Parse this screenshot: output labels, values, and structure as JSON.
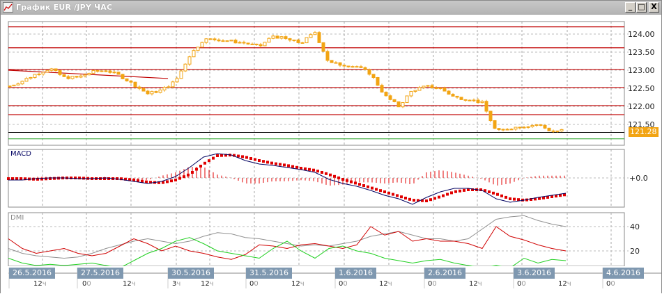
{
  "window": {
    "title": "График EUR /JPY  ЧАС",
    "minimize": "_",
    "maximize": "□",
    "close": "X"
  },
  "price_axis": {
    "labels": [
      "124.00",
      "123.50",
      "123.00",
      "122.50",
      "122.00",
      "121.50"
    ],
    "current_price": "121.28"
  },
  "macd": {
    "label": "MACD",
    "axis_label": "+0.0"
  },
  "dmi": {
    "label": "DMI",
    "axis_labels": [
      "40",
      "20"
    ]
  },
  "timeline": {
    "dates": [
      "26.5.2016",
      "27.5.2016",
      "30.5.2016",
      "31.5.2016",
      "1.6.2016",
      "2.6.2016",
      "3.6.2016",
      "4.6.2016"
    ],
    "hours": [
      [
        "12",
        "ч"
      ],
      [
        "0",
        "0"
      ],
      [
        "12",
        "ч"
      ],
      [
        "3",
        "ч"
      ],
      [
        "12",
        "ч"
      ],
      [
        "0",
        "0"
      ],
      [
        "12",
        "ч"
      ],
      [
        "0",
        "0"
      ],
      [
        "12",
        "ч"
      ],
      [
        "0",
        "0"
      ],
      [
        "12",
        "ч"
      ],
      [
        "0",
        "0"
      ],
      [
        "12",
        "ч"
      ],
      [
        "0",
        "0"
      ]
    ]
  },
  "colors": {
    "candle": "#f2a413",
    "level": "#c00000",
    "macd": "#000060",
    "signal": "#e00000",
    "adx": "#909090",
    "plus_di": "#d00000",
    "minus_di": "#20d020"
  },
  "chart_data": {
    "type": "line",
    "price_close": [
      122.55,
      122.7,
      122.9,
      123.05,
      122.8,
      122.8,
      122.95,
      123.0,
      122.85,
      122.6,
      122.35,
      122.45,
      122.7,
      123.4,
      123.85,
      123.85,
      123.8,
      123.75,
      123.65,
      123.95,
      123.85,
      123.75,
      124.05,
      123.2,
      123.15,
      123.1,
      122.9,
      122.3,
      122.0,
      122.45,
      122.55,
      122.5,
      122.25,
      122.2,
      122.1,
      121.3,
      121.4,
      121.45,
      121.5,
      121.3,
      121.35
    ],
    "levels": [
      124.2,
      123.62,
      123.02,
      122.52,
      122.02,
      121.77
    ],
    "black_level": 121.28,
    "green_level": 121.1,
    "trendline": [
      123.0,
      122.77
    ],
    "price_ylim": [
      121.0,
      124.35
    ],
    "macd": [
      -3,
      -3,
      -1,
      0,
      0,
      -1,
      -1,
      0,
      -2,
      -5,
      -8,
      -5,
      2,
      15,
      30,
      35,
      33,
      25,
      20,
      18,
      15,
      12,
      8,
      -2,
      -8,
      -12,
      -18,
      -25,
      -30,
      -38,
      -28,
      -20,
      -15,
      -15,
      -18,
      -30,
      -35,
      -32,
      -28,
      -25,
      -22
    ],
    "signal": [
      -1,
      -1,
      -2,
      -1,
      0,
      0,
      -1,
      -1,
      -1,
      -3,
      -6,
      -7,
      -3,
      5,
      20,
      32,
      33,
      30,
      25,
      21,
      18,
      14,
      11,
      5,
      -2,
      -8,
      -14,
      -20,
      -26,
      -32,
      -33,
      -27,
      -20,
      -17,
      -17,
      -23,
      -30,
      -32,
      -30,
      -27,
      -24
    ],
    "adx": [
      22,
      18,
      16,
      15,
      14,
      15,
      18,
      22,
      25,
      28,
      30,
      28,
      26,
      28,
      32,
      35,
      34,
      31,
      30,
      28,
      26,
      24,
      25,
      24,
      26,
      28,
      32,
      34,
      36,
      33,
      30,
      30,
      28,
      30,
      38,
      46,
      48,
      49,
      45,
      42,
      40
    ],
    "plus_di": [
      30,
      22,
      18,
      20,
      22,
      18,
      16,
      18,
      24,
      30,
      26,
      20,
      24,
      20,
      18,
      15,
      13,
      17,
      25,
      24,
      22,
      25,
      26,
      24,
      22,
      25,
      40,
      33,
      36,
      28,
      30,
      28,
      28,
      26,
      22,
      40,
      32,
      29,
      25,
      22,
      20
    ],
    "minus_di": [
      14,
      10,
      8,
      9,
      8,
      9,
      10,
      8,
      6,
      12,
      18,
      22,
      28,
      31,
      26,
      20,
      18,
      16,
      14,
      22,
      28,
      20,
      14,
      22,
      24,
      20,
      18,
      14,
      12,
      10,
      12,
      13,
      10,
      8,
      6,
      8,
      6,
      14,
      10,
      13,
      12
    ]
  }
}
